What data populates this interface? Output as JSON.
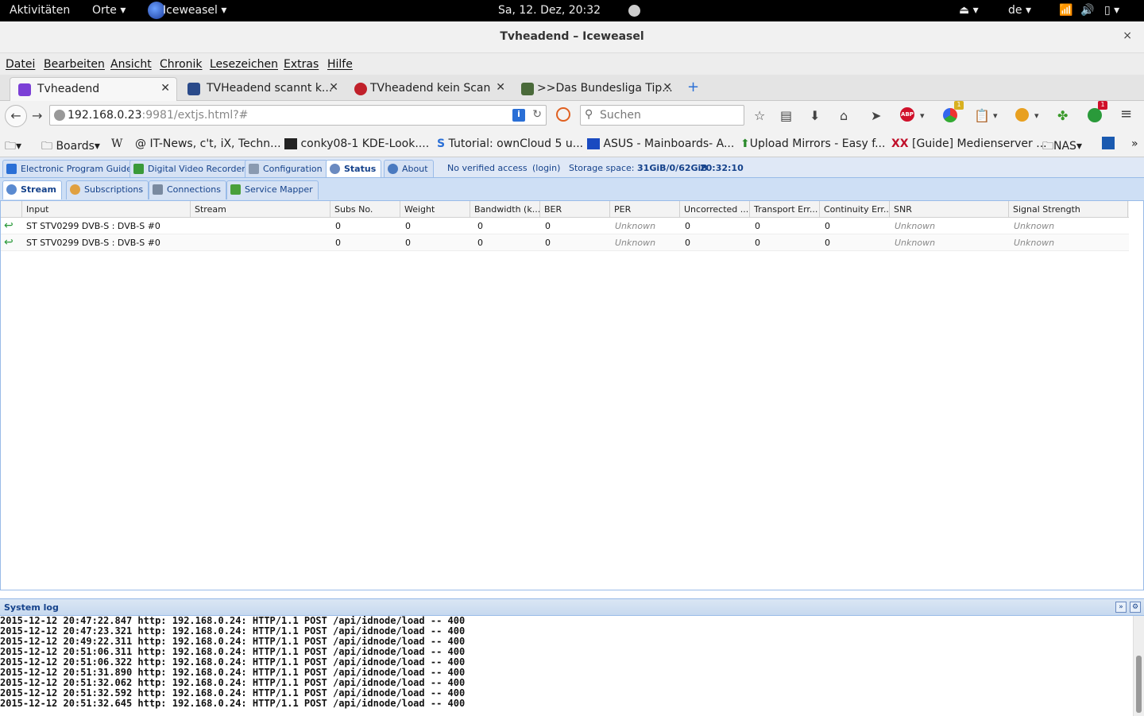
{
  "topbar": {
    "activities": "Aktivitäten",
    "places": "Orte",
    "app": "Iceweasel",
    "clock": "Sa, 12. Dez, 20:32",
    "lang": "de"
  },
  "window": {
    "title": "Tvheadend – Iceweasel",
    "close": "×"
  },
  "menu": [
    "Datei",
    "Bearbeiten",
    "Ansicht",
    "Chronik",
    "Lesezeichen",
    "Extras",
    "Hilfe"
  ],
  "tabs": [
    {
      "label": "Tvheadend",
      "active": true,
      "color": "#7b3fd6"
    },
    {
      "label": "TVHeadend scannt k...",
      "active": false,
      "color": "#2a4a8a"
    },
    {
      "label": "TVheadend kein Scan",
      "active": false,
      "color": "#c0202a"
    },
    {
      "label": ">>Das Bundesliga Tip...",
      "active": false,
      "color": "#4a6a3a"
    }
  ],
  "nav": {
    "url_host": "192.168.0.23",
    "url_rest": ":9981/extjs.html?#",
    "search_placeholder": "Suchen"
  },
  "bookmarks": [
    "Boards",
    "W",
    "IT-News, c't, iX, Techn...",
    "conky08-1 KDE-Look....",
    "Tutorial: ownCloud 5 u...",
    "ASUS - Mainboards- A...",
    "Upload Mirrors - Easy f...",
    "[Guide] Medienserver ...",
    "NAS"
  ],
  "tvh": {
    "main_tabs": [
      "Electronic Program Guide",
      "Digital Video Recorder",
      "Configuration",
      "Status",
      "About"
    ],
    "access": "No verified access",
    "login": "(login)",
    "storage_label": "Storage space:",
    "storage_value": "31GiB/0/62GiB",
    "time": "20:32:10",
    "sub_tabs": [
      "Stream",
      "Subscriptions",
      "Connections",
      "Service Mapper"
    ],
    "columns": [
      "Input",
      "Stream",
      "Subs No.",
      "Weight",
      "Bandwidth (k...",
      "BER",
      "PER",
      "Uncorrected ...",
      "Transport Err...",
      "Continuity Err...",
      "SNR",
      "Signal Strength"
    ],
    "rows": [
      {
        "input": "ST STV0299 DVB-S : DVB-S #0",
        "stream": "",
        "subs": "0",
        "weight": "0",
        "bandwidth": "0",
        "ber": "0",
        "per": "Unknown",
        "unc": "0",
        "te": "0",
        "cc": "0",
        "snr": "Unknown",
        "signal": "Unknown"
      },
      {
        "input": "ST STV0299 DVB-S : DVB-S #0",
        "stream": "",
        "subs": "0",
        "weight": "0",
        "bandwidth": "0",
        "ber": "0",
        "per": "Unknown",
        "unc": "0",
        "te": "0",
        "cc": "0",
        "snr": "Unknown",
        "signal": "Unknown"
      }
    ],
    "log_title": "System log",
    "log_lines": [
      "2015-12-12 20:47:22.847 http: 192.168.0.24: HTTP/1.1 POST /api/idnode/load -- 400",
      "2015-12-12 20:47:23.321 http: 192.168.0.24: HTTP/1.1 POST /api/idnode/load -- 400",
      "2015-12-12 20:49:22.311 http: 192.168.0.24: HTTP/1.1 POST /api/idnode/load -- 400",
      "2015-12-12 20:51:06.311 http: 192.168.0.24: HTTP/1.1 POST /api/idnode/load -- 400",
      "2015-12-12 20:51:06.322 http: 192.168.0.24: HTTP/1.1 POST /api/idnode/load -- 400",
      "2015-12-12 20:51:31.890 http: 192.168.0.24: HTTP/1.1 POST /api/idnode/load -- 400",
      "2015-12-12 20:51:32.062 http: 192.168.0.24: HTTP/1.1 POST /api/idnode/load -- 400",
      "2015-12-12 20:51:32.592 http: 192.168.0.24: HTTP/1.1 POST /api/idnode/load -- 400",
      "2015-12-12 20:51:32.645 http: 192.168.0.24: HTTP/1.1 POST /api/idnode/load -- 400"
    ]
  }
}
